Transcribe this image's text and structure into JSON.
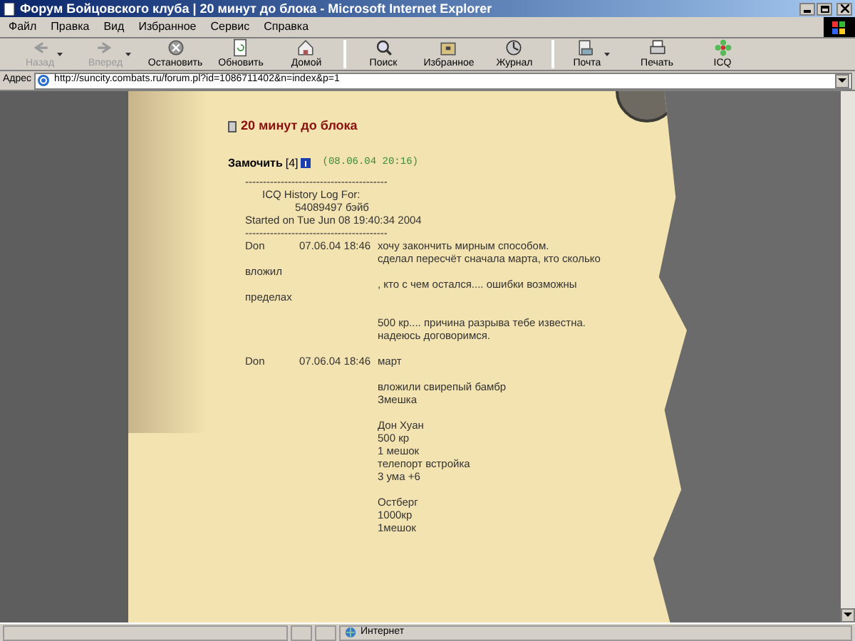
{
  "window": {
    "title": "Форум Бойцовского клуба | 20 минут до блока - Microsoft Internet Explorer"
  },
  "menu": [
    "Файл",
    "Правка",
    "Вид",
    "Избранное",
    "Сервис",
    "Справка"
  ],
  "toolbar": [
    {
      "label": "Назад",
      "disabled": true,
      "dropdown": true
    },
    {
      "label": "Вперед",
      "disabled": true,
      "dropdown": true
    },
    {
      "label": "Остановить",
      "disabled": false,
      "dropdown": false
    },
    {
      "label": "Обновить",
      "disabled": false,
      "dropdown": false
    },
    {
      "label": "Домой",
      "disabled": false,
      "dropdown": false
    },
    {
      "label": "Поиск",
      "disabled": false,
      "dropdown": false
    },
    {
      "label": "Избранное",
      "disabled": false,
      "dropdown": false
    },
    {
      "label": "Журнал",
      "disabled": false,
      "dropdown": false
    },
    {
      "label": "Почта",
      "disabled": false,
      "dropdown": true
    },
    {
      "label": "Печать",
      "disabled": false,
      "dropdown": false
    },
    {
      "label": "ICQ",
      "disabled": false,
      "dropdown": false
    }
  ],
  "address": {
    "label": "Адрес",
    "url": "http://suncity.combats.ru/forum.pl?id=1086711402&n=index&p=1"
  },
  "post": {
    "title": "20 минут до блока",
    "author": "Замочить",
    "level": "[4]",
    "date": "(08.06.04 20:16)"
  },
  "log": [
    [
      {
        "kind": "rule",
        "text": "----------------------------------------"
      },
      {
        "kind": "indent1",
        "text": "ICQ History Log For:"
      },
      {
        "kind": "indent2",
        "text": "54089497  бэйб"
      },
      {
        "kind": "plain",
        "text": "Started on Tue Jun 08 19:40:34 2004"
      },
      {
        "kind": "rule",
        "text": "----------------------------------------"
      },
      {
        "kind": "entry",
        "name": "Don",
        "time": "07.06.04 18:46",
        "text": "хочу закончить мирным способом."
      },
      {
        "kind": "cont",
        "text": "сделал пересчёт сначала марта, кто сколько"
      },
      {
        "kind": "plain",
        "text": "вложил"
      },
      {
        "kind": "cont",
        "text": ", кто с чем остался.... ошибки возможны"
      },
      {
        "kind": "plain",
        "text": "пределах"
      }
    ],
    [
      {
        "kind": "cont",
        "text": "500 кр.... причина разрыва тебе известна."
      },
      {
        "kind": "cont",
        "text": "надеюсь договоримся."
      }
    ],
    [
      {
        "kind": "entry",
        "name": "Don",
        "time": "07.06.04 18:46",
        "text": "март"
      }
    ],
    [
      {
        "kind": "cont",
        "text": "вложили свирепый бамбр"
      },
      {
        "kind": "cont",
        "text": "Змешка"
      }
    ],
    [
      {
        "kind": "cont",
        "text": "Дон Хуан"
      },
      {
        "kind": "cont",
        "text": "500 кр"
      },
      {
        "kind": "cont",
        "text": "1 мешок"
      },
      {
        "kind": "cont",
        "text": "телепорт встройка"
      },
      {
        "kind": "cont",
        "text": "3 ума +6"
      }
    ],
    [
      {
        "kind": "cont",
        "text": "Остберг"
      },
      {
        "kind": "cont",
        "text": "1000кр"
      },
      {
        "kind": "cont",
        "text": "1мешок"
      }
    ]
  ],
  "status_bar": {
    "zone": "Интернет"
  }
}
